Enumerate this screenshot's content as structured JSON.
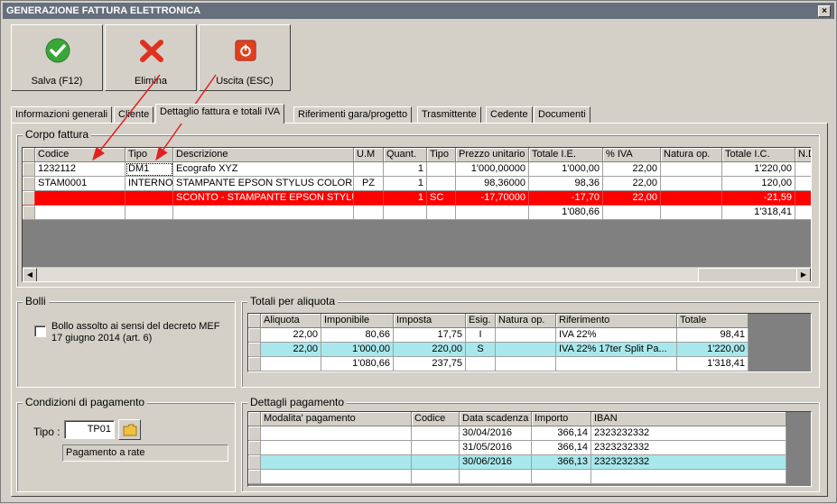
{
  "window": {
    "title": "GENERAZIONE FATTURA ELETTRONICA",
    "close": "×"
  },
  "toolbar": {
    "save_label": "Salva (F12)",
    "delete_label": "Elimina",
    "exit_label": "Uscita (ESC)"
  },
  "tabs": [
    "Informazioni generali",
    "Cliente",
    "Dettaglio fattura e totali IVA",
    "Riferimenti gara/progetto",
    "Trasmittente",
    "Cedente",
    "Documenti"
  ],
  "corpo": {
    "legend": "Corpo fattura",
    "headers": [
      "Codice",
      "Tipo",
      "Descrizione",
      "U.M",
      "Quant.",
      "Tipo",
      "Prezzo unitario",
      "Totale I.E.",
      "% IVA",
      "Natura op.",
      "Totale I.C.",
      "N.D"
    ],
    "rows": [
      [
        "1232112",
        "DM1",
        "Ecografo XYZ",
        "",
        "1",
        "",
        "1'000,00000",
        "1'000,00",
        "22,00",
        "",
        "1'220,00",
        ""
      ],
      [
        "STAM0001",
        "INTERNO",
        "STAMPANTE EPSON STYLUS COLOR C...",
        "PZ",
        "1",
        "",
        "98,36000",
        "98,36",
        "22,00",
        "",
        "120,00",
        ""
      ],
      [
        "",
        "",
        "SCONTO - STAMPANTE EPSON STYLU...",
        "",
        "1",
        "SC",
        "-17,70000",
        "-17,70",
        "22,00",
        "",
        "-21,59",
        ""
      ],
      [
        "",
        "",
        "",
        "",
        "",
        "",
        "",
        "1'080,66",
        "",
        "",
        "1'318,41",
        ""
      ]
    ]
  },
  "bolli": {
    "legend": "Bolli",
    "checkbox_label_1": "Bollo assolto ai sensi del decreto MEF",
    "checkbox_label_2": "17 giugno 2014 (art. 6)"
  },
  "totali": {
    "legend": "Totali per aliquota",
    "headers": [
      "Aliquota",
      "Imponibile",
      "Imposta",
      "Esig.",
      "Natura op.",
      "Riferimento",
      "Totale"
    ],
    "rows": [
      [
        "22,00",
        "80,66",
        "17,75",
        "I",
        "",
        "IVA 22%",
        "98,41"
      ],
      [
        "22,00",
        "1'000,00",
        "220,00",
        "S",
        "",
        "IVA 22% 17ter Split Pa...",
        "1'220,00"
      ],
      [
        "",
        "1'080,66",
        "237,75",
        "",
        "",
        "",
        "1'318,41"
      ]
    ]
  },
  "condizioni": {
    "legend": "Condizioni di pagamento",
    "tipo_label": "Tipo :",
    "tipo_value": "TP01",
    "descr": "Pagamento a rate"
  },
  "dettagli": {
    "legend": "Dettagli pagamento",
    "headers": [
      "Modalita' pagamento",
      "Codice",
      "Data scadenza",
      "Importo",
      "IBAN"
    ],
    "rows": [
      [
        "",
        "",
        "30/04/2016",
        "366,14",
        "2323232332"
      ],
      [
        "",
        "",
        "31/05/2016",
        "366,14",
        "2323232332"
      ],
      [
        "",
        "",
        "30/06/2016",
        "366,13",
        "2323232332"
      ],
      [
        "",
        "",
        "",
        "",
        ""
      ]
    ]
  },
  "colors": {
    "titlebar": "#666f7c",
    "face": "#d4d0c8",
    "red_row": "#ff0000",
    "cyan_row": "#a8e8ec",
    "arrow": "#e02020"
  }
}
